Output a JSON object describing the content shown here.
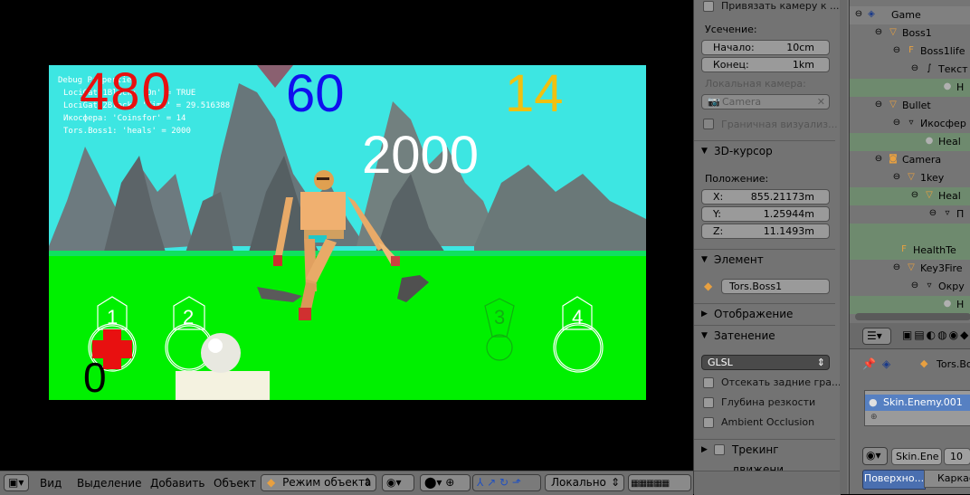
{
  "game": {
    "debug_title": "Debug Properties",
    "debug_lines": [
      "LociGate1Block: 'On' = TRUE",
      "LociGate2Block: 'Time' = 29.516388",
      "Икосфера: 'Coinsfor' = 14",
      "Tors.Boss1: 'heals' = 2000"
    ],
    "score_red": "480",
    "score_blue": "60",
    "score_yellow": "14",
    "score_white": "2000",
    "counter_black": "0",
    "slot_labels": [
      "1",
      "2",
      "3",
      "4"
    ],
    "colors": {
      "sky": "#3de6e2",
      "ground": "#00ff00",
      "mountain": "#6e7878",
      "red": "#e81010",
      "blue": "#1010ee",
      "yellow": "#f0c010"
    }
  },
  "header3d": {
    "menu_view": "Вид",
    "menu_select": "Выделение",
    "menu_add": "Добавить",
    "menu_object": "Объект",
    "mode": "Режим объекта",
    "orientation": "Локально"
  },
  "props": {
    "bind_camera": "Привязать камеру к ...",
    "clipping_label": "Усечение:",
    "clip_start_label": "Начало:",
    "clip_start_value": "10cm",
    "clip_end_label": "Конец:",
    "clip_end_value": "1km",
    "local_camera_label": "Локальная камера:",
    "camera_field": "Camera",
    "bounds_checkbox": "Граничная визуализ...",
    "cursor_panel": "3D-курсор",
    "position_label": "Положение:",
    "x_label": "X:",
    "x_value": "855.21173m",
    "y_label": "Y:",
    "y_value": "1.25944m",
    "z_label": "Z:",
    "z_value": "11.1493m",
    "item_panel": "Элемент",
    "item_name": "Tors.Boss1",
    "display_panel": "Отображение",
    "shading_panel": "Затенение",
    "shading_mode": "GLSL",
    "backface": "Отсекать задние гра...",
    "dof": "Глубина резкости",
    "ao": "Ambient Occlusion",
    "motion_tracking": "Трекинг движени..."
  },
  "outliner": {
    "rows": [
      {
        "label": "Game",
        "indent": 0
      },
      {
        "label": "Boss1",
        "indent": 1
      },
      {
        "label": "Boss1life",
        "indent": 2
      },
      {
        "label": "Текст",
        "indent": 3
      },
      {
        "label": "H",
        "indent": 4
      },
      {
        "label": "Bullet",
        "indent": 1
      },
      {
        "label": "Икосфер",
        "indent": 2
      },
      {
        "label": "Heal",
        "indent": 3
      },
      {
        "label": "Camera",
        "indent": 1
      },
      {
        "label": "1key",
        "indent": 2
      },
      {
        "label": "Heal",
        "indent": 3
      },
      {
        "label": "П",
        "indent": 4
      },
      {
        "label": "",
        "indent": 5
      },
      {
        "label": "HealthTe",
        "indent": 2
      },
      {
        "label": "Key3Fire",
        "indent": 2
      },
      {
        "label": "Окру",
        "indent": 3
      },
      {
        "label": "H",
        "indent": 4
      }
    ]
  },
  "material": {
    "breadcrumb": "Tors.Bos",
    "slot_name": "Skin.Enemy.001",
    "datablock": "Skin.Ene",
    "users": "10",
    "tab_surface": "Поверхно...",
    "tab_wire": "Каркас"
  }
}
